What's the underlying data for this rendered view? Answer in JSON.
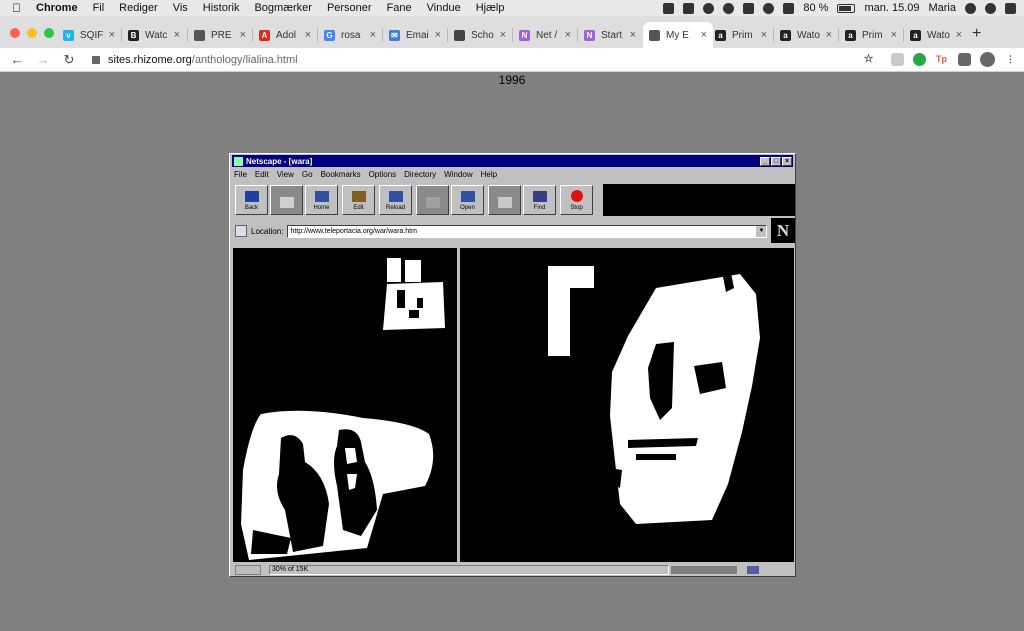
{
  "menubar": {
    "app": "Chrome",
    "items": [
      "Fil",
      "Rediger",
      "Vis",
      "Historik",
      "Bogmærker",
      "Personer",
      "Fane",
      "Vindue",
      "Hjælp"
    ],
    "battery": "80 %",
    "clock": "man. 15.09",
    "user": "Maria"
  },
  "tabs": [
    {
      "title": "SQIF",
      "icon": "vimeo-icon",
      "color": "#1ab7ea",
      "glyph": "v"
    },
    {
      "title": "Watc",
      "icon": "bfi-icon",
      "color": "#222222",
      "glyph": "B"
    },
    {
      "title": "PRE",
      "icon": "box-icon",
      "color": "#555555",
      "glyph": ""
    },
    {
      "title": "Adol",
      "icon": "adobe-icon",
      "color": "#e0281d",
      "glyph": "A"
    },
    {
      "title": "rosa",
      "icon": "google-icon",
      "color": "#4285f4",
      "glyph": "G"
    },
    {
      "title": "Emai",
      "icon": "email-icon",
      "color": "#3b7ddd",
      "glyph": "✉"
    },
    {
      "title": "Scho",
      "icon": "globe-icon",
      "color": "#444444",
      "glyph": ""
    },
    {
      "title": "Net /",
      "icon": "net-art-icon",
      "color": "#a060e0",
      "glyph": "N"
    },
    {
      "title": "Start",
      "icon": "net-art-icon",
      "color": "#a060e0",
      "glyph": "N"
    },
    {
      "title": "My E",
      "icon": "globe-icon",
      "color": "#555555",
      "glyph": ""
    },
    {
      "title": "Prim",
      "icon": "amazon-icon",
      "color": "#222222",
      "glyph": "a"
    },
    {
      "title": "Wato",
      "icon": "amazon-icon",
      "color": "#222222",
      "glyph": "a"
    },
    {
      "title": "Prim",
      "icon": "amazon-icon",
      "color": "#222222",
      "glyph": "a"
    },
    {
      "title": "Wato",
      "icon": "amazon-icon",
      "color": "#222222",
      "glyph": "a"
    }
  ],
  "active_tab": 9,
  "address": {
    "host": "sites.rhizome.org",
    "path": "/anthology/lialina.html"
  },
  "page": {
    "year": "1996"
  },
  "netscape": {
    "title": "Netscape - [wara]",
    "menu": [
      "File",
      "Edit",
      "View",
      "Go",
      "Bookmarks",
      "Options",
      "Directory",
      "Window",
      "Help"
    ],
    "buttons": [
      {
        "label": "Back",
        "icon": "back-arrow-icon",
        "enabled": true
      },
      {
        "label": "",
        "icon": "forward-arrow-icon",
        "enabled": false
      },
      {
        "label": "Home",
        "icon": "home-icon",
        "enabled": true
      },
      {
        "label": "Edit",
        "icon": "pencil-icon",
        "enabled": true
      },
      {
        "label": "Reload",
        "icon": "reload-icon",
        "enabled": true
      },
      {
        "label": "",
        "icon": "images-icon",
        "enabled": false
      },
      {
        "label": "Open",
        "icon": "open-icon",
        "enabled": true
      },
      {
        "label": "",
        "icon": "print-icon",
        "enabled": false
      },
      {
        "label": "Find",
        "icon": "binoculars-icon",
        "enabled": true
      },
      {
        "label": "Stop",
        "icon": "stop-icon",
        "enabled": true
      }
    ],
    "location_label": "Location:",
    "location_value": "http://www.teleportacia.org/war/wara.htm",
    "logo_letter": "N",
    "status": "30% of 15K"
  }
}
